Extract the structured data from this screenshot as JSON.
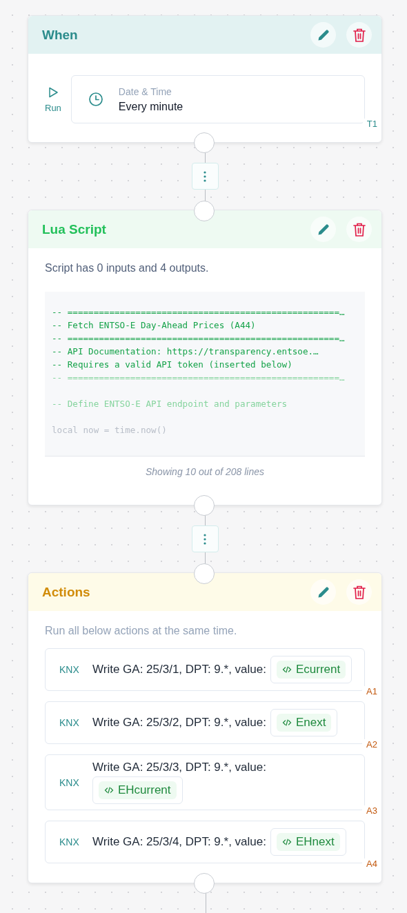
{
  "blocks": [
    {
      "kind": "trigger",
      "title": "When",
      "run_label": "Run",
      "trigger": {
        "label": "Date & Time",
        "value": "Every minute",
        "tag": "T1"
      }
    },
    {
      "kind": "script",
      "title": "Lua Script",
      "summary": "Script has 0 inputs and 4 outputs.",
      "code_lines": [
        {
          "kind": "comment",
          "faded": false,
          "text": "-- ====================================================…"
        },
        {
          "kind": "comment",
          "faded": false,
          "text": "-- Fetch ENTSO-E Day-Ahead Prices (A44)"
        },
        {
          "kind": "comment",
          "faded": false,
          "text": "-- ====================================================…"
        },
        {
          "kind": "comment",
          "faded": false,
          "text": "-- API Documentation: https://transparency.entsoe.…"
        },
        {
          "kind": "comment",
          "faded": false,
          "text": "-- Requires a valid API token (inserted below)"
        },
        {
          "kind": "comment",
          "faded": true,
          "text": "-- ====================================================…"
        },
        {
          "kind": "blank"
        },
        {
          "kind": "comment",
          "faded": true,
          "text": "-- Define ENTSO-E API endpoint and parameters"
        },
        {
          "kind": "blank"
        },
        {
          "kind": "code",
          "faded": true,
          "text": "local now = time.now()"
        }
      ],
      "footer": "Showing 10 out of 208 lines"
    },
    {
      "kind": "actions",
      "title": "Actions",
      "summary": "Run all below actions at the same time.",
      "actions": [
        {
          "protocol": "KNX",
          "text": "Write GA: 25/3/1, DPT: 9.*, value:",
          "variable": "Ecurrent",
          "tag": "A1"
        },
        {
          "protocol": "KNX",
          "text": "Write GA: 25/3/2, DPT: 9.*, value:",
          "variable": "Enext",
          "tag": "A2"
        },
        {
          "protocol": "KNX",
          "text": "Write GA: 25/3/3, DPT: 9.*, value:",
          "variable": "EHcurrent",
          "tag": "A3"
        },
        {
          "protocol": "KNX",
          "text": "Write GA: 25/3/4, DPT: 9.*, value:",
          "variable": "EHnext",
          "tag": "A4"
        }
      ]
    }
  ]
}
